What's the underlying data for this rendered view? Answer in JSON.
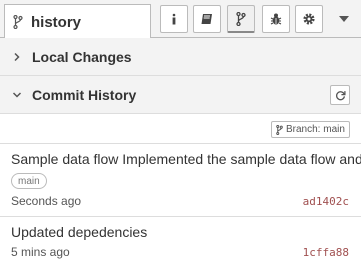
{
  "header": {
    "tab_title": "history",
    "tools": [
      {
        "icon": "info-icon"
      },
      {
        "icon": "book-icon"
      },
      {
        "icon": "git-branch-icon"
      },
      {
        "icon": "bug-icon"
      },
      {
        "icon": "gear-icon"
      }
    ],
    "menu_icon": "caret-down-icon"
  },
  "sections": {
    "local_changes": {
      "title": "Local Changes",
      "expanded": false
    },
    "commit_history": {
      "title": "Commit History",
      "expanded": true
    }
  },
  "branch": {
    "label": "Branch: main"
  },
  "commits": [
    {
      "message": "Sample data flow Implemented the sample data flow and",
      "ref": "main",
      "time": "Seconds ago",
      "sha": "ad1402c"
    },
    {
      "message": "Updated depedencies",
      "time": "5 mins ago",
      "sha": "1cffa88"
    }
  ],
  "colors": {
    "sha": "#a05050",
    "panel_bg": "#f3f3f3",
    "border": "#bbbbbb"
  }
}
